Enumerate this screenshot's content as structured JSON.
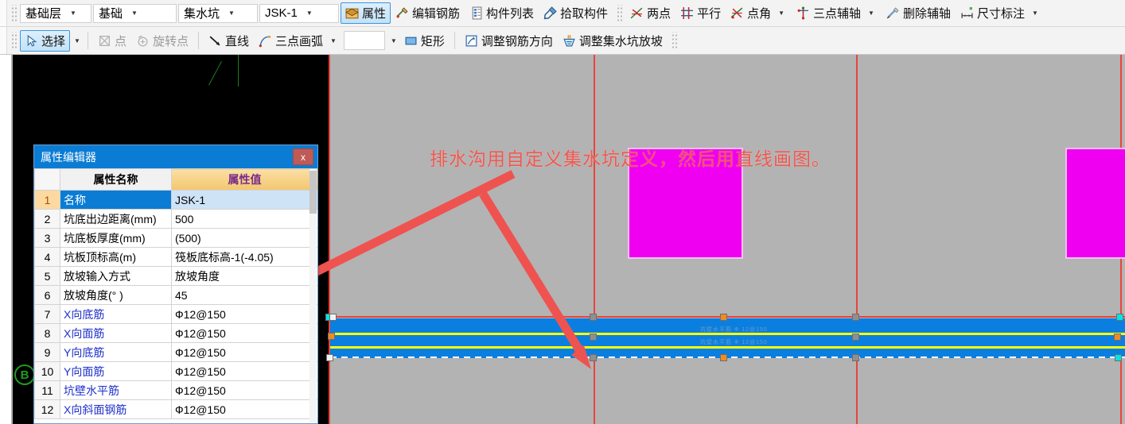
{
  "toolbar_row1": {
    "combos": [
      {
        "name": "combo-floor",
        "value": "基础层"
      },
      {
        "name": "combo-category",
        "value": "基础"
      },
      {
        "name": "combo-component",
        "value": "集水坑"
      },
      {
        "name": "combo-name",
        "value": "JSK-1"
      }
    ],
    "buttons": [
      {
        "name": "properties",
        "label": "属性",
        "icon": "properties-icon",
        "active": true,
        "caret": false
      },
      {
        "name": "edit-rebar",
        "label": "编辑钢筋",
        "icon": "edit-rebar-icon",
        "active": false,
        "caret": false
      },
      {
        "name": "component-list",
        "label": "构件列表",
        "icon": "component-list-icon",
        "active": false,
        "caret": false
      },
      {
        "name": "pick-component",
        "label": "拾取构件",
        "icon": "pick-component-icon",
        "active": false,
        "caret": false
      },
      {
        "name": "two-point",
        "label": "两点",
        "icon": "two-point-icon",
        "active": false,
        "caret": false
      },
      {
        "name": "parallel",
        "label": "平行",
        "icon": "parallel-icon",
        "active": false,
        "caret": false
      },
      {
        "name": "point-angle",
        "label": "点角",
        "icon": "point-angle-icon",
        "active": false,
        "caret": true
      },
      {
        "name": "three-point-aux-axis",
        "label": "三点辅轴",
        "icon": "three-point-aux-axis-icon",
        "active": false,
        "caret": true
      },
      {
        "name": "delete-aux-axis",
        "label": "删除辅轴",
        "icon": "delete-aux-axis-icon",
        "active": false,
        "caret": false
      },
      {
        "name": "dimension",
        "label": "尺寸标注",
        "icon": "dimension-icon",
        "active": false,
        "caret": true
      }
    ]
  },
  "toolbar_row2": {
    "buttons": [
      {
        "name": "select",
        "label": "选择",
        "icon": "cursor-icon",
        "active": true,
        "caret": true,
        "disabled": false
      },
      {
        "name": "point",
        "label": "点",
        "icon": "point-icon",
        "active": false,
        "caret": false,
        "disabled": true
      },
      {
        "name": "rotate-point",
        "label": "旋转点",
        "icon": "rotate-point-icon",
        "active": false,
        "caret": false,
        "disabled": true
      },
      {
        "name": "line",
        "label": "直线",
        "icon": "line-icon",
        "active": false,
        "caret": false,
        "disabled": false
      },
      {
        "name": "three-point-arc",
        "label": "三点画弧",
        "icon": "three-point-arc-icon",
        "active": false,
        "caret": true,
        "disabled": false
      },
      {
        "name": "rectangle",
        "label": "矩形",
        "icon": "rectangle-icon",
        "active": false,
        "caret": false,
        "disabled": false
      },
      {
        "name": "adjust-rebar-direction",
        "label": "调整钢筋方向",
        "icon": "adjust-rebar-direction-icon",
        "active": false,
        "caret": false,
        "disabled": false
      },
      {
        "name": "adjust-sump-slope",
        "label": "调整集水坑放坡",
        "icon": "adjust-sump-slope-icon",
        "active": false,
        "caret": false,
        "disabled": false
      }
    ]
  },
  "property_editor": {
    "title": "属性编辑器",
    "close_label": "x",
    "headers": {
      "index": "",
      "name": "属性名称",
      "value": "属性值"
    },
    "rows": [
      {
        "index": "1",
        "name": "名称",
        "value": "JSK-1",
        "selected": true,
        "link": false
      },
      {
        "index": "2",
        "name": "坑底出边距离(mm)",
        "value": "500",
        "selected": false,
        "link": false
      },
      {
        "index": "3",
        "name": "坑底板厚度(mm)",
        "value": "(500)",
        "selected": false,
        "link": false
      },
      {
        "index": "4",
        "name": "坑板顶标高(m)",
        "value": "筏板底标高-1(-4.05)",
        "selected": false,
        "link": false
      },
      {
        "index": "5",
        "name": "放坡输入方式",
        "value": "放坡角度",
        "selected": false,
        "link": false
      },
      {
        "index": "6",
        "name": "放坡角度(° )",
        "value": "45",
        "selected": false,
        "link": false
      },
      {
        "index": "7",
        "name": "X向底筋",
        "value": "Ф12@150",
        "selected": false,
        "link": true
      },
      {
        "index": "8",
        "name": "X向面筋",
        "value": "Ф12@150",
        "selected": false,
        "link": true
      },
      {
        "index": "9",
        "name": "Y向底筋",
        "value": "Ф12@150",
        "selected": false,
        "link": true
      },
      {
        "index": "10",
        "name": "Y向面筋",
        "value": "Ф12@150",
        "selected": false,
        "link": true
      },
      {
        "index": "11",
        "name": "坑壁水平筋",
        "value": "Ф12@150",
        "selected": false,
        "link": true
      },
      {
        "index": "12",
        "name": "X向斜面钢筋",
        "value": "Ф12@150",
        "selected": false,
        "link": true
      }
    ]
  },
  "canvas": {
    "annotation_note": "排水沟用自定义集水坑定义，然后用直线画图。",
    "axis_bubble_label": "B",
    "band_labels": [
      "坑壁水平筋 Ф 12@150",
      "坑壁水平筋 Ф 12@150"
    ],
    "colors": {
      "background_black": "#000000",
      "background_gray": "#b3b3b3",
      "grid_line_red": "#e8443c",
      "rebar_blue": "#0a7fe0",
      "rebar_yellow": "#ffff00",
      "sump_magenta": "#f000f0",
      "annotation_red": "#f0574f",
      "axis_green": "#1f9b1f"
    }
  }
}
